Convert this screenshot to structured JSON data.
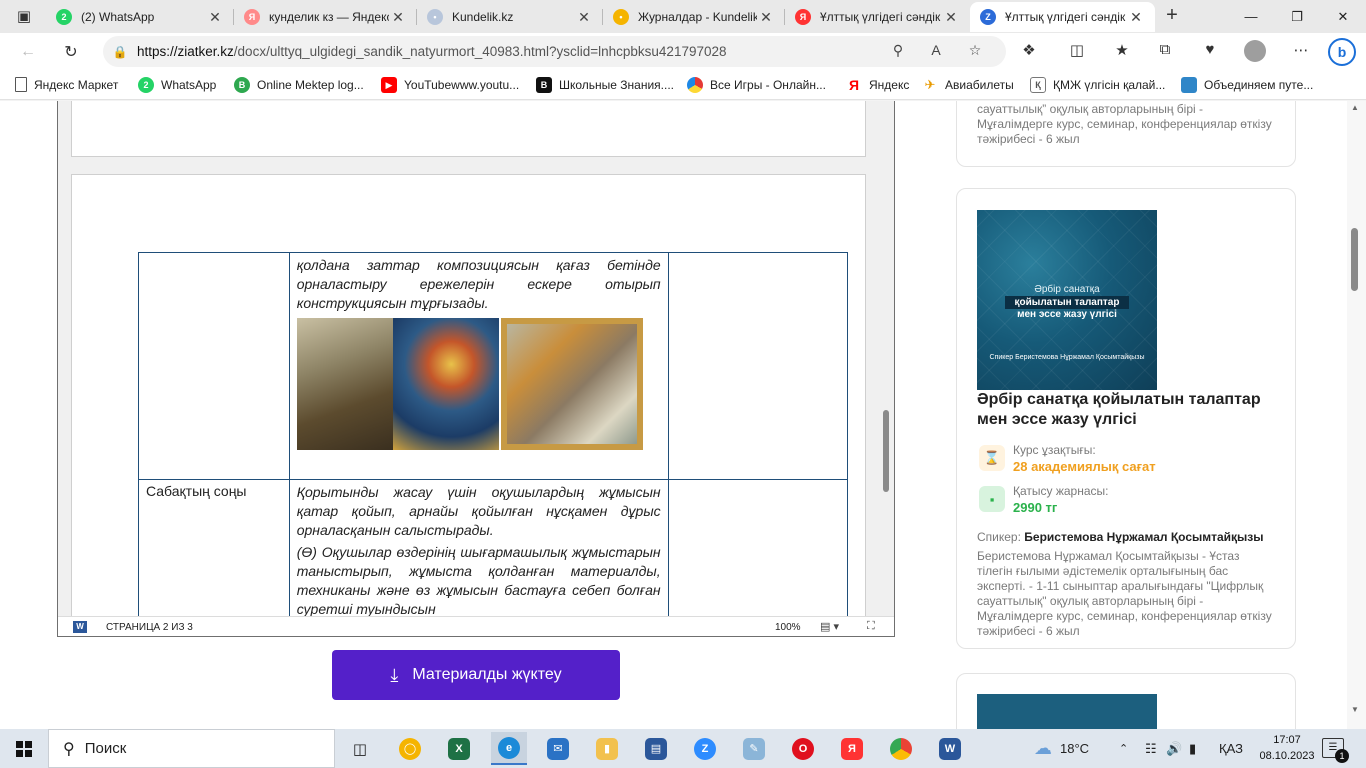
{
  "browser": {
    "tabs": [
      {
        "title": "(2) WhatsApp",
        "fav": "2",
        "color": "#25d366"
      },
      {
        "title": "кунделик кз — Яндекс",
        "fav": "Я",
        "color": "#ff5b5b"
      },
      {
        "title": "Kundelik.kz",
        "fav": "•",
        "color": "#b8c6db"
      },
      {
        "title": "Журналдар - Kundelik",
        "fav": "•",
        "color": "#f5b400"
      },
      {
        "title": "Ұлттық үлгідегі сәндік",
        "fav": "Я",
        "color": "#ff3333"
      },
      {
        "title": "Ұлттық үлгідегі сәндік",
        "fav": "Z",
        "color": "#2c6bd8"
      }
    ],
    "url_domain": "https://ziatker.kz",
    "url_path": "/docx/ulttyq_ulgidegi_sandik_natyurmort_40983.html?ysclid=lnhcpbksu421797028"
  },
  "bookmarks": [
    {
      "label": "Яндекс Маркет",
      "color": "#f5f5f5",
      "icon": "document-icon"
    },
    {
      "label": "WhatsApp",
      "color": "#25d366",
      "icon": "2"
    },
    {
      "label": "Online Mektep log...",
      "color": "#2ea84f",
      "icon": "B"
    },
    {
      "label": "YouTubewww.youtu...",
      "color": "#ff0000",
      "icon": "▶"
    },
    {
      "label": "Школьные Знания....",
      "color": "#111111",
      "icon": "B"
    },
    {
      "label": "Все Игры - Онлайн...",
      "color": "#f2c200",
      "icon": "●"
    },
    {
      "label": "Яндекс",
      "color": "#ffffff",
      "icon": "Я"
    },
    {
      "label": "Авиабилеты",
      "color": "#ffffff",
      "icon": "✈"
    },
    {
      "label": "ҚМЖ үлгісін қалай...",
      "color": "#777777",
      "icon": "Қ"
    },
    {
      "label": "Объединяем путе...",
      "color": "#2f86c8",
      "icon": "■"
    }
  ],
  "document": {
    "row1_text": "қолдана заттар композициясын қағаз бетінде орналастыру ережелерін ескере отырып конструкциясын тұрғызады.",
    "row2_label": "Сабақтың соңы",
    "row2_text1": "Қорытынды жасау үшін оқушылардың жұмысын қатар қойып, арнайы қойылған нұсқамен дұрыс орналасқанын салыстырады.",
    "row2_text2": "(Ө) Оқушылар өздерінің шығармашылық жұмыстарын таныстырып, жұмыста қолданған материалды, техниканы және өз жұмысын бастауға себеп болған суретші туындысын",
    "page_indicator": "СТРАНИЦА 2 ИЗ 3",
    "zoom": "100%"
  },
  "download_button": "Материалды жүктеу",
  "sidebar": {
    "top_card_desc": "сауаттылық” оқулық авторларының бірі - Мұғалімдерге курс, семинар, конференциялар өткізу тәжірибесі - 6 жыл",
    "cover_line1": "Әрбір санатқа",
    "cover_line2": "қойылатын талаптар",
    "cover_line3": "мен эссе жазу үлгісі",
    "cover_author": "Спикер Беристемова Нұржамал Қосымтайқызы",
    "card_title": "Әрбір санатқа қойылатын талаптар мен эссе жазу үлгісі",
    "duration_label": "Курс ұзақтығы:",
    "duration_value": "28 академиялық сағат",
    "fee_label": "Қатысу жарнасы:",
    "fee_value": "2990 тг",
    "speaker_label": "Спикер:",
    "speaker_name": "Беристемова Нұржамал Қосымтайқызы",
    "speaker_desc": "Беристемова Нұржамал Қосымтайқызы - Ұстаз тілегін ғылыми әдістемелік орталығының бас эксперті. - 1-11 сыныптар аралығындағы \"Цифрлық сауаттылық\" оқулық авторларының бірі - Мұғалімдерге курс, семинар, конференциялар өткізу тәжірибесі - 6 жыл"
  },
  "taskbar": {
    "search_placeholder": "Поиск",
    "weather": "18°C",
    "lang": "ҚАЗ",
    "time": "17:07",
    "date": "08.10.2023",
    "notifications": "1"
  },
  "colors": {
    "accent": "#5420c9",
    "duration_color": "#f0a020",
    "fee_color": "#2bb24c",
    "table_border": "#1f4e79"
  }
}
